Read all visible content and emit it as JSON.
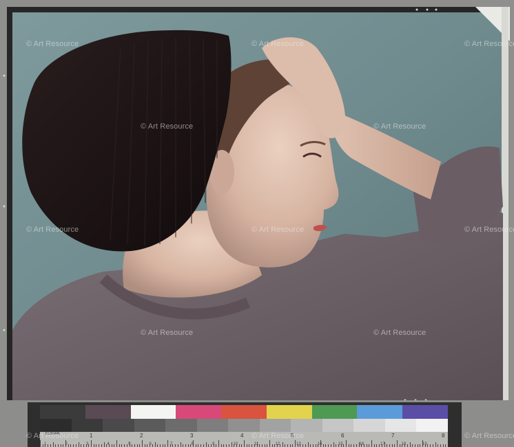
{
  "watermark": {
    "text": "Art Resource",
    "symbol": "©"
  },
  "target_card": {
    "brand": "KODAK",
    "color_patches": [
      "#3b3b3b",
      "#5a4a54",
      "#f4f4f2",
      "#d8497a",
      "#d9533e",
      "#e2d34d",
      "#4e9a52",
      "#5b9bd9",
      "#5a4ea6"
    ],
    "gray_steps": [
      "#2c2c2c",
      "#3a3a3a",
      "#4a4a4a",
      "#5b5b5b",
      "#6c6c6c",
      "#7e7e7e",
      "#909090",
      "#a2a2a2",
      "#b4b4b4",
      "#c6c6c6",
      "#d6d6d6",
      "#e6e6e6",
      "#f2f2f2"
    ],
    "inch_labels": [
      "1",
      "2",
      "3",
      "4",
      "5",
      "6",
      "7",
      "8"
    ],
    "cm_labels": [
      "1",
      "2",
      "3",
      "4",
      "5",
      "6",
      "7",
      "8",
      "9",
      "10",
      "11",
      "12",
      "13",
      "14",
      "15",
      "16",
      "17",
      "18",
      "19"
    ]
  },
  "colors": {
    "backdrop": "#6f8b8e",
    "hat": "#1c1314",
    "sweater": "#6e6268",
    "skin": "#d8b7a6",
    "hair": "#6b4a3c",
    "lips": "#c0504a",
    "frame": "#2a2a2a"
  }
}
